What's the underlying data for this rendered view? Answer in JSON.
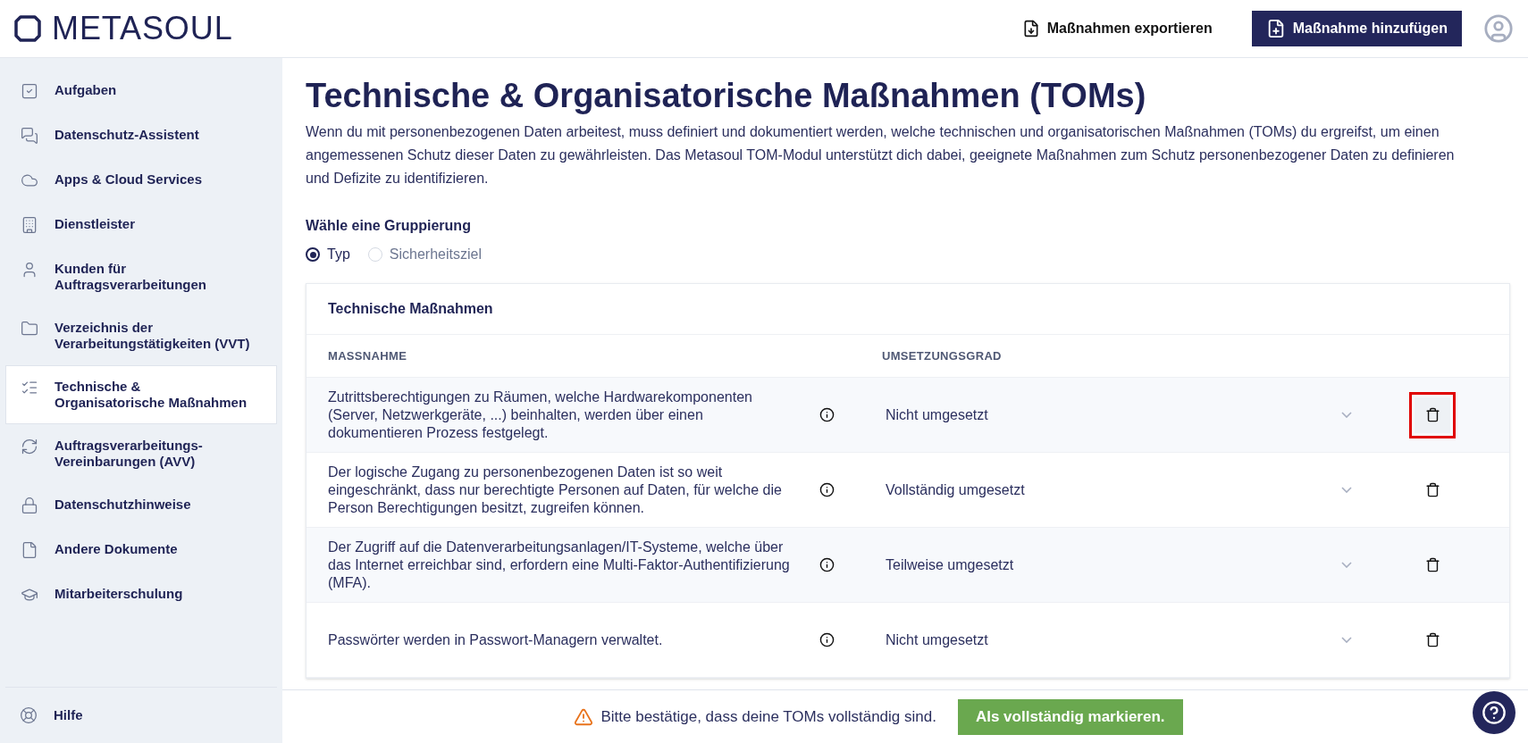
{
  "header": {
    "logo": "METASOUL",
    "export_button": "Maßnahmen exportieren",
    "add_button": "Maßnahme hinzufügen"
  },
  "sidebar": {
    "items": [
      {
        "label": "Aufgaben",
        "selected": false
      },
      {
        "label": "Datenschutz-Assistent",
        "selected": false
      },
      {
        "label": "Apps & Cloud Services",
        "selected": false
      },
      {
        "label": "Dienstleister",
        "selected": false
      },
      {
        "label": "Kunden für Auftragsverarbeitungen",
        "selected": false
      },
      {
        "label": "Verzeichnis der Verarbeitungstätigkeiten (VVT)",
        "selected": false
      },
      {
        "label": "Technische & Organisatorische Maßnahmen",
        "selected": true
      },
      {
        "label": "Auftragsverarbeitungs-Vereinbarungen (AVV)",
        "selected": false
      },
      {
        "label": "Datenschutzhinweise",
        "selected": false
      },
      {
        "label": "Andere Dokumente",
        "selected": false
      },
      {
        "label": "Mitarbeiterschulung",
        "selected": false
      }
    ],
    "help": "Hilfe"
  },
  "page": {
    "title": "Technische & Organisatorische Maßnahmen (TOMs)",
    "intro": "Wenn du mit personenbezogenen Daten arbeitest, muss definiert und dokumentiert werden, welche technischen und organisatorischen Maßnahmen (TOMs) du ergreifst, um einen angemessenen Schutz dieser Daten zu gewährleisten. Das Metasoul TOM-Modul unterstützt dich dabei, geeignete Maßnahmen zum Schutz personenbezogener Daten zu definieren und Defizite zu identifizieren."
  },
  "grouping": {
    "label": "Wähle eine Gruppierung",
    "options": [
      {
        "label": "Typ",
        "selected": true
      },
      {
        "label": "Sicherheitsziel",
        "selected": false
      }
    ]
  },
  "table": {
    "title": "Technische Maßnahmen",
    "columns": [
      "MASSNAHME",
      "UMSETZUNGSGRAD"
    ],
    "rows": [
      {
        "measure": "Zutrittsberechtigungen zu Räumen, welche Hardwarekomponenten (Server, Netzwerkgeräte, ...) beinhalten, werden über einen dokumentieren Prozess festgelegt.",
        "degree": "Nicht umgesetzt",
        "highlighted": true
      },
      {
        "measure": "Der logische Zugang zu personenbezogenen Daten ist so weit eingeschränkt, dass nur berechtigte Personen auf Daten, für welche die Person Berechtigungen besitzt, zugreifen können.",
        "degree": "Vollständig umgesetzt",
        "highlighted": false
      },
      {
        "measure": "Der Zugriff auf die Datenverarbeitungsanlagen/IT-Systeme, welche über das Internet erreichbar sind, erfordern eine Multi-Faktor-Authentifizierung (MFA).",
        "degree": "Teilweise umgesetzt",
        "highlighted": false
      },
      {
        "measure": "Passwörter werden in Passwort-Managern verwaltet.",
        "degree": "Nicht umgesetzt",
        "highlighted": false
      }
    ]
  },
  "footer": {
    "warning": "Bitte bestätige, dass deine TOMs vollständig sind.",
    "button": "Als vollständig markieren."
  }
}
